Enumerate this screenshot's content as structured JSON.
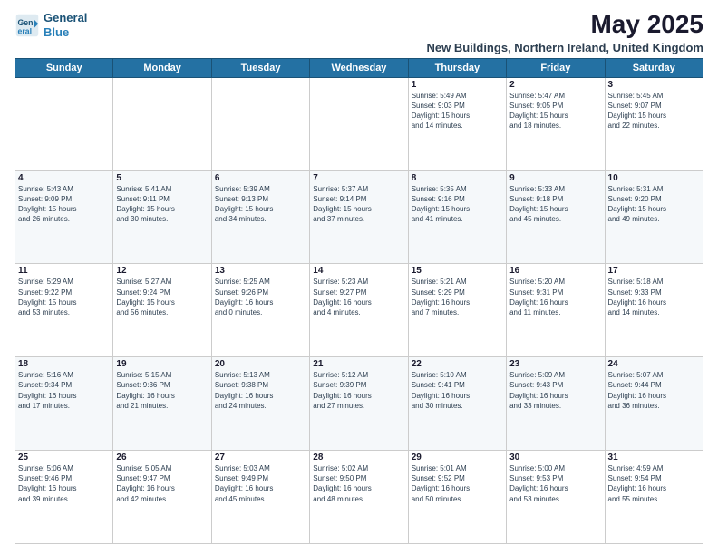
{
  "logo": {
    "line1": "General",
    "line2": "Blue"
  },
  "title": "May 2025",
  "subtitle": "New Buildings, Northern Ireland, United Kingdom",
  "days_header": [
    "Sunday",
    "Monday",
    "Tuesday",
    "Wednesday",
    "Thursday",
    "Friday",
    "Saturday"
  ],
  "weeks": [
    [
      {
        "num": "",
        "info": ""
      },
      {
        "num": "",
        "info": ""
      },
      {
        "num": "",
        "info": ""
      },
      {
        "num": "",
        "info": ""
      },
      {
        "num": "1",
        "info": "Sunrise: 5:49 AM\nSunset: 9:03 PM\nDaylight: 15 hours\nand 14 minutes."
      },
      {
        "num": "2",
        "info": "Sunrise: 5:47 AM\nSunset: 9:05 PM\nDaylight: 15 hours\nand 18 minutes."
      },
      {
        "num": "3",
        "info": "Sunrise: 5:45 AM\nSunset: 9:07 PM\nDaylight: 15 hours\nand 22 minutes."
      }
    ],
    [
      {
        "num": "4",
        "info": "Sunrise: 5:43 AM\nSunset: 9:09 PM\nDaylight: 15 hours\nand 26 minutes."
      },
      {
        "num": "5",
        "info": "Sunrise: 5:41 AM\nSunset: 9:11 PM\nDaylight: 15 hours\nand 30 minutes."
      },
      {
        "num": "6",
        "info": "Sunrise: 5:39 AM\nSunset: 9:13 PM\nDaylight: 15 hours\nand 34 minutes."
      },
      {
        "num": "7",
        "info": "Sunrise: 5:37 AM\nSunset: 9:14 PM\nDaylight: 15 hours\nand 37 minutes."
      },
      {
        "num": "8",
        "info": "Sunrise: 5:35 AM\nSunset: 9:16 PM\nDaylight: 15 hours\nand 41 minutes."
      },
      {
        "num": "9",
        "info": "Sunrise: 5:33 AM\nSunset: 9:18 PM\nDaylight: 15 hours\nand 45 minutes."
      },
      {
        "num": "10",
        "info": "Sunrise: 5:31 AM\nSunset: 9:20 PM\nDaylight: 15 hours\nand 49 minutes."
      }
    ],
    [
      {
        "num": "11",
        "info": "Sunrise: 5:29 AM\nSunset: 9:22 PM\nDaylight: 15 hours\nand 53 minutes."
      },
      {
        "num": "12",
        "info": "Sunrise: 5:27 AM\nSunset: 9:24 PM\nDaylight: 15 hours\nand 56 minutes."
      },
      {
        "num": "13",
        "info": "Sunrise: 5:25 AM\nSunset: 9:26 PM\nDaylight: 16 hours\nand 0 minutes."
      },
      {
        "num": "14",
        "info": "Sunrise: 5:23 AM\nSunset: 9:27 PM\nDaylight: 16 hours\nand 4 minutes."
      },
      {
        "num": "15",
        "info": "Sunrise: 5:21 AM\nSunset: 9:29 PM\nDaylight: 16 hours\nand 7 minutes."
      },
      {
        "num": "16",
        "info": "Sunrise: 5:20 AM\nSunset: 9:31 PM\nDaylight: 16 hours\nand 11 minutes."
      },
      {
        "num": "17",
        "info": "Sunrise: 5:18 AM\nSunset: 9:33 PM\nDaylight: 16 hours\nand 14 minutes."
      }
    ],
    [
      {
        "num": "18",
        "info": "Sunrise: 5:16 AM\nSunset: 9:34 PM\nDaylight: 16 hours\nand 17 minutes."
      },
      {
        "num": "19",
        "info": "Sunrise: 5:15 AM\nSunset: 9:36 PM\nDaylight: 16 hours\nand 21 minutes."
      },
      {
        "num": "20",
        "info": "Sunrise: 5:13 AM\nSunset: 9:38 PM\nDaylight: 16 hours\nand 24 minutes."
      },
      {
        "num": "21",
        "info": "Sunrise: 5:12 AM\nSunset: 9:39 PM\nDaylight: 16 hours\nand 27 minutes."
      },
      {
        "num": "22",
        "info": "Sunrise: 5:10 AM\nSunset: 9:41 PM\nDaylight: 16 hours\nand 30 minutes."
      },
      {
        "num": "23",
        "info": "Sunrise: 5:09 AM\nSunset: 9:43 PM\nDaylight: 16 hours\nand 33 minutes."
      },
      {
        "num": "24",
        "info": "Sunrise: 5:07 AM\nSunset: 9:44 PM\nDaylight: 16 hours\nand 36 minutes."
      }
    ],
    [
      {
        "num": "25",
        "info": "Sunrise: 5:06 AM\nSunset: 9:46 PM\nDaylight: 16 hours\nand 39 minutes."
      },
      {
        "num": "26",
        "info": "Sunrise: 5:05 AM\nSunset: 9:47 PM\nDaylight: 16 hours\nand 42 minutes."
      },
      {
        "num": "27",
        "info": "Sunrise: 5:03 AM\nSunset: 9:49 PM\nDaylight: 16 hours\nand 45 minutes."
      },
      {
        "num": "28",
        "info": "Sunrise: 5:02 AM\nSunset: 9:50 PM\nDaylight: 16 hours\nand 48 minutes."
      },
      {
        "num": "29",
        "info": "Sunrise: 5:01 AM\nSunset: 9:52 PM\nDaylight: 16 hours\nand 50 minutes."
      },
      {
        "num": "30",
        "info": "Sunrise: 5:00 AM\nSunset: 9:53 PM\nDaylight: 16 hours\nand 53 minutes."
      },
      {
        "num": "31",
        "info": "Sunrise: 4:59 AM\nSunset: 9:54 PM\nDaylight: 16 hours\nand 55 minutes."
      }
    ]
  ]
}
